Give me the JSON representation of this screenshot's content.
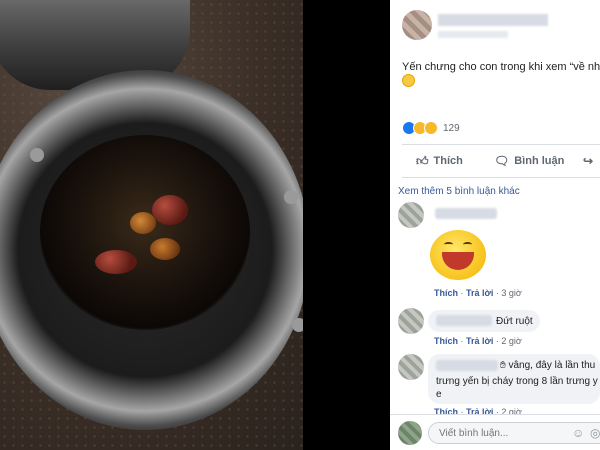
{
  "post": {
    "text": "Yến chưng cho con trong khi xem “về nh",
    "reaction_count": "129",
    "actions": {
      "like": "Thích",
      "comment": "Bình luận"
    }
  },
  "comments": {
    "more_link": "Xem thêm 5 bình luận khác",
    "items": [
      {
        "text": "",
        "like": "Thích",
        "reply": "Trả lời",
        "time": "3 giờ"
      },
      {
        "text": "Đứt ruột",
        "like": "Thích",
        "reply": "Trả lời",
        "time": "2 giờ"
      },
      {
        "line1": "vâng, đây là lần thu",
        "line2": "trưng yến bị cháy trong 8 lần trưng y",
        "line3": "e",
        "like": "Thích",
        "reply": "Trả lời",
        "time": "2 giờ"
      }
    ]
  },
  "composer": {
    "placeholder": "Viết bình luận..."
  },
  "colors": {
    "link": "#385898",
    "like_blue": "#1877f2",
    "haha_yellow": "#f7b928"
  }
}
